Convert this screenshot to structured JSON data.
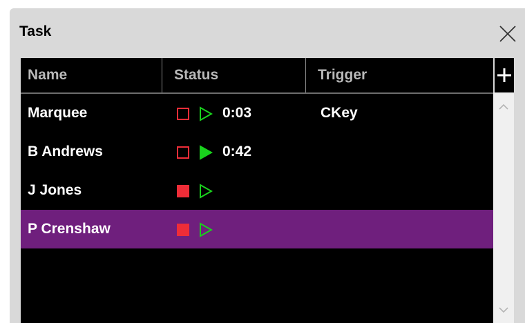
{
  "window": {
    "title": "Task"
  },
  "table": {
    "columns": [
      "Name",
      "Status",
      "Trigger"
    ],
    "rows": [
      {
        "name": "Marquee",
        "stop_state": "outline",
        "play_state": "outline",
        "timer": "0:03",
        "trigger": "CKey",
        "selected": false
      },
      {
        "name": "B Andrews",
        "stop_state": "outline",
        "play_state": "filled",
        "timer": "0:42",
        "trigger": "",
        "selected": false
      },
      {
        "name": "J Jones",
        "stop_state": "filled",
        "play_state": "outline",
        "timer": "",
        "trigger": "",
        "selected": false
      },
      {
        "name": "P Crenshaw",
        "stop_state": "filled",
        "play_state": "outline",
        "timer": "",
        "trigger": "",
        "selected": true
      }
    ]
  },
  "colors": {
    "panel": "#d9d9d9",
    "grid_background": "#000000",
    "header_text": "#b9b9b9",
    "row_text": "#ffffff",
    "selected_row": "#6f1f7d",
    "stop_red": "#ee2d38",
    "play_green": "#19d21d"
  },
  "icons": {
    "close": "close-icon",
    "add": "plus-icon",
    "stop": "stop-square-icon",
    "play": "play-triangle-icon",
    "scroll_up": "chevron-up-icon",
    "scroll_down": "chevron-down-icon"
  }
}
